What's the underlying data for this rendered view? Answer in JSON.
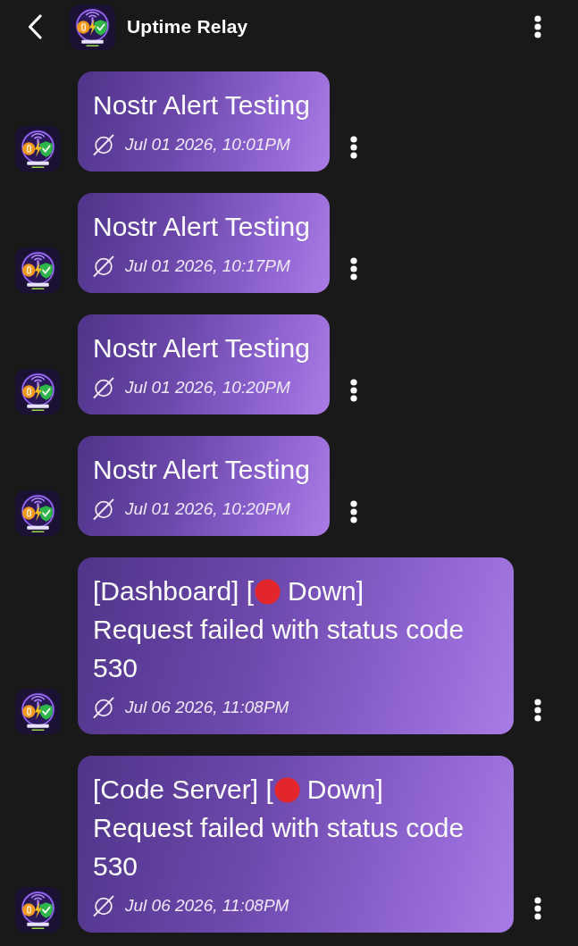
{
  "header": {
    "title": "Uptime Relay"
  },
  "messages": [
    {
      "lines": [
        [
          {
            "kind": "text",
            "text": "Nostr Alert Testing"
          }
        ]
      ],
      "time": "Jul 01 2026, 10:01PM"
    },
    {
      "lines": [
        [
          {
            "kind": "text",
            "text": "Nostr Alert Testing"
          }
        ]
      ],
      "time": "Jul 01 2026, 10:17PM"
    },
    {
      "lines": [
        [
          {
            "kind": "text",
            "text": "Nostr Alert Testing"
          }
        ]
      ],
      "time": "Jul 01 2026, 10:20PM"
    },
    {
      "lines": [
        [
          {
            "kind": "text",
            "text": "Nostr Alert Testing"
          }
        ]
      ],
      "time": "Jul 01 2026, 10:20PM"
    },
    {
      "lines": [
        [
          {
            "kind": "text",
            "text": "[Dashboard] ["
          },
          {
            "kind": "dot",
            "color": "#e3262b"
          },
          {
            "kind": "text",
            "text": "Down]"
          }
        ],
        [
          {
            "kind": "text",
            "text": "Request failed with status code 530"
          }
        ]
      ],
      "time": "Jul 06 2026, 11:08PM"
    },
    {
      "lines": [
        [
          {
            "kind": "text",
            "text": "[Code Server] ["
          },
          {
            "kind": "dot",
            "color": "#e3262b"
          },
          {
            "kind": "text",
            "text": "Down]"
          }
        ],
        [
          {
            "kind": "text",
            "text": "Request failed with status code 530"
          }
        ]
      ],
      "time": "Jul 06 2026, 11:08PM"
    }
  ]
}
